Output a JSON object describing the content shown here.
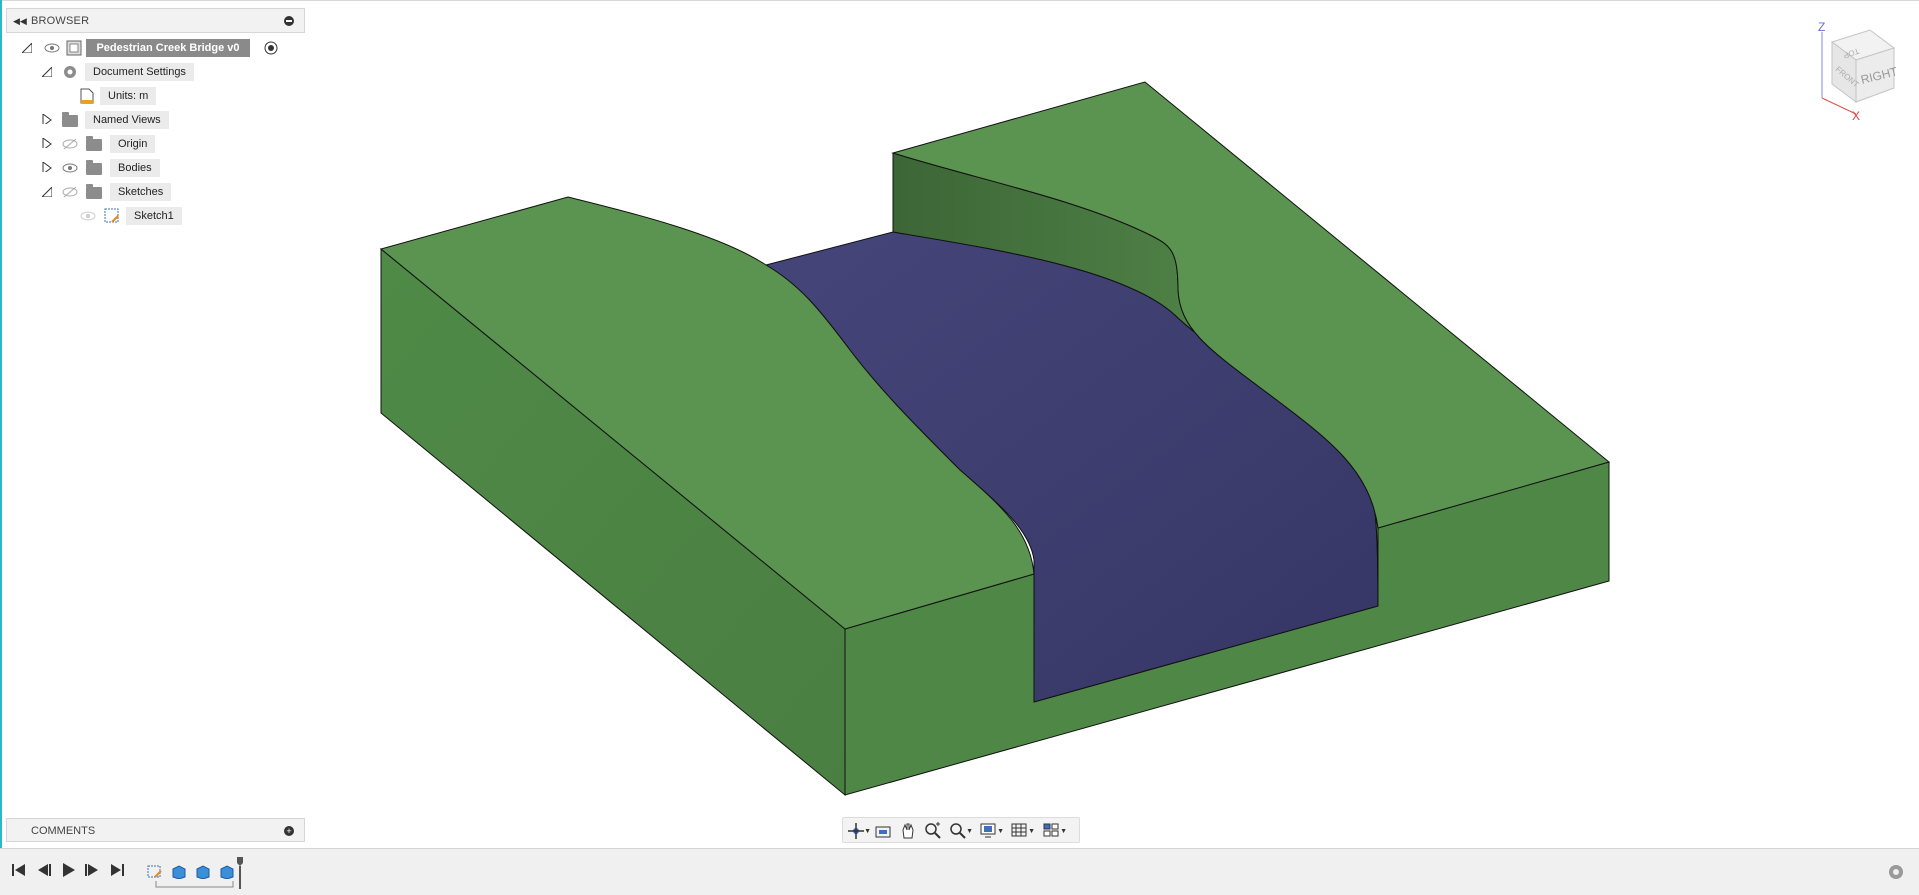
{
  "browser": {
    "title": "BROWSER",
    "root": "Pedestrian Creek Bridge v0",
    "items": [
      {
        "label": "Document Settings"
      },
      {
        "label": "Units: m"
      },
      {
        "label": "Named Views"
      },
      {
        "label": "Origin"
      },
      {
        "label": "Bodies"
      },
      {
        "label": "Sketches"
      },
      {
        "label": "Sketch1"
      }
    ]
  },
  "comments": {
    "title": "COMMENTS"
  },
  "viewcube": {
    "face_right": "RIGHT",
    "face_front": "FRONT",
    "face_top": "TOP",
    "axis_z": "Z",
    "axis_x": "X"
  },
  "colors": {
    "terrain_top": "#5a9150",
    "terrain_side": "#4e8546",
    "water": "#3f3f73",
    "accent": "#2bb7c6"
  },
  "nav_tools": [
    "orbit-icon",
    "look-at-icon",
    "pan-icon",
    "zoom-icon",
    "zoom-window-icon",
    "display-settings-icon",
    "grid-icon",
    "viewports-icon"
  ],
  "timeline": {
    "controls": [
      "first-icon",
      "previous-icon",
      "play-icon",
      "next-icon",
      "last-icon"
    ],
    "features": [
      "sketch-feature-icon",
      "extrude-feature-icon",
      "extrude-feature-icon",
      "extrude-feature-icon"
    ]
  }
}
